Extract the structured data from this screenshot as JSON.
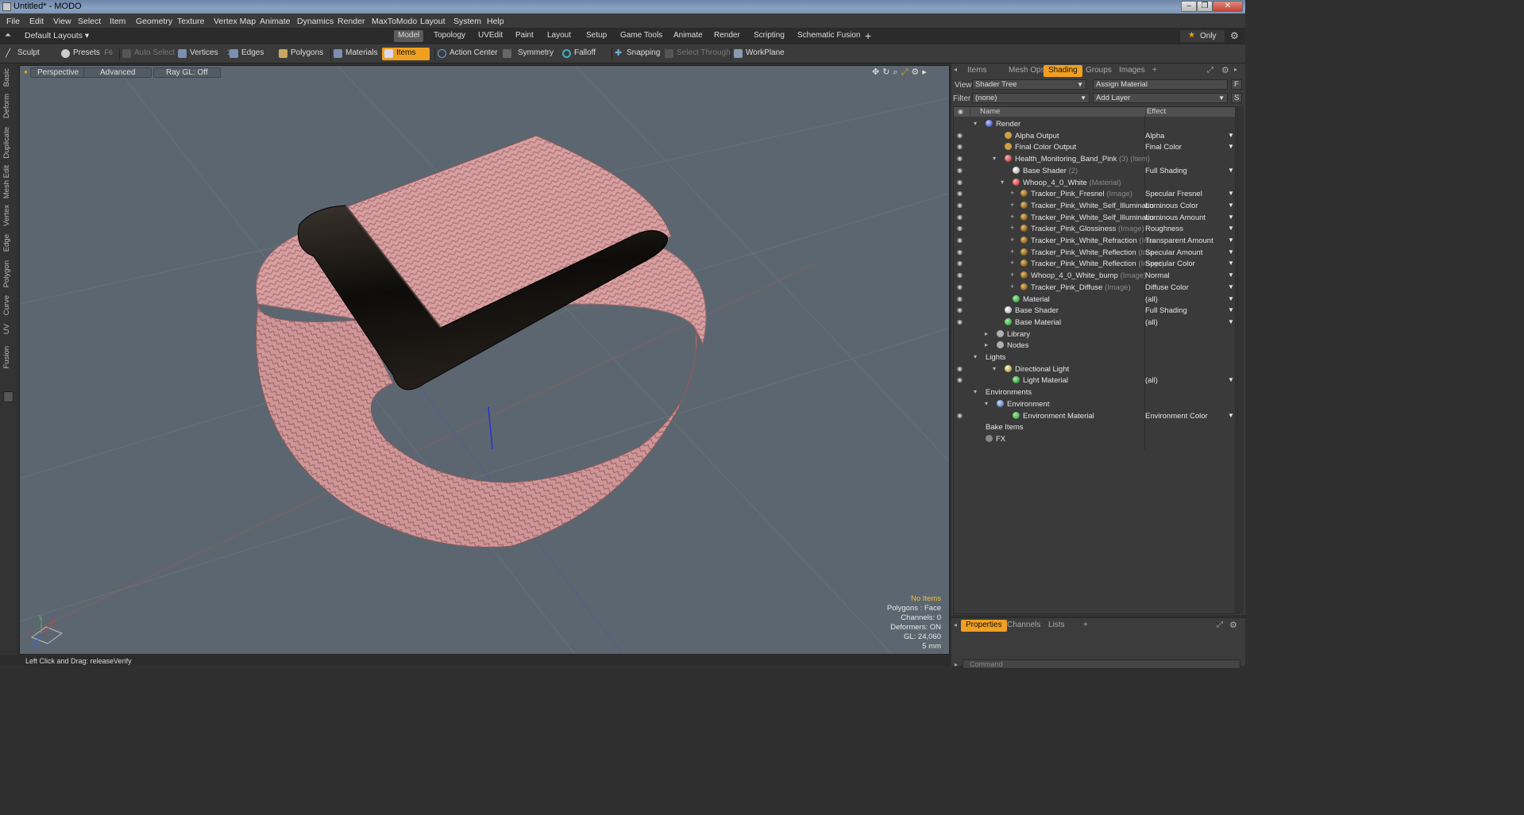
{
  "window": {
    "title": "Untitled* - MODO",
    "controls": [
      "–",
      "❐",
      "✕"
    ]
  },
  "menus": [
    "File",
    "Edit",
    "View",
    "Select",
    "Item",
    "Geometry",
    "Texture",
    "Vertex Map",
    "Animate",
    "Dynamics",
    "Render",
    "MaxToModo",
    "Layout",
    "System",
    "Help"
  ],
  "layout_selector": "Default Layouts",
  "mode_tabs": [
    "Model",
    "Topology",
    "UVEdit",
    "Paint",
    "Layout",
    "Setup",
    "Game Tools",
    "Animate",
    "Render",
    "Scripting",
    "Schematic Fusion"
  ],
  "mode_active": "Model",
  "add_tab": "+",
  "only_label": "Only",
  "toolbar": {
    "sculpt": "Sculpt",
    "presets": "Presets",
    "presets_key": "F6",
    "auto_select": "Auto Select",
    "vertices": "Vertices",
    "vertices_key": "1",
    "edges": "Edges",
    "edges_key": "2",
    "polygons": "Polygons",
    "materials": "Materials",
    "items": "Items",
    "action_center": "Action Center",
    "symmetry": "Symmetry",
    "falloff": "Falloff",
    "snapping": "Snapping",
    "select_through": "Select Through",
    "workplane": "WorkPlane"
  },
  "left_tabs": [
    "Basic",
    "Deform",
    "Duplicate",
    "Mesh Edit",
    "Vertex",
    "Edge",
    "Polygon",
    "Curve",
    "UV",
    "Fusion"
  ],
  "viewport": {
    "perspective": "Perspective",
    "advanced": "Advanced",
    "raygl": "Ray GL: Off",
    "hud": {
      "items": "No Items",
      "polygons": "Polygons : Face",
      "channels": "Channels: 0",
      "deformers": "Deformers: ON",
      "gl": "GL: 24,060",
      "unit": "5 mm"
    },
    "colors": {
      "band": "#d49a9c",
      "clasp": "#141210",
      "bg": "#5b6670"
    }
  },
  "panel": {
    "tabs": [
      "Items",
      "Mesh Ops",
      "Shading",
      "Groups",
      "Images"
    ],
    "active_tab": "Shading",
    "add": "+",
    "view_label": "View",
    "view_value": "Shader Tree",
    "assign_material": "Assign Material",
    "f_key": "F",
    "filter_label": "Filter",
    "filter_value": "(none)",
    "add_layer": "Add Layer",
    "s_key": "S",
    "col_name": "Name",
    "col_effect": "Effect",
    "rows": [
      {
        "name": "Render",
        "type": "",
        "effect": "",
        "eye": false,
        "glyph": "blue"
      },
      {
        "name": "Alpha Output",
        "type": "",
        "effect": "Alpha",
        "eye": true,
        "glyph": "output"
      },
      {
        "name": "Final Color Output",
        "type": "",
        "effect": "Final Color",
        "eye": true,
        "glyph": "output"
      },
      {
        "name": "Health_Monitoring_Band_Pink",
        "type": "(3) (Item)",
        "effect": "",
        "eye": true,
        "glyph": "red"
      },
      {
        "name": "Base Shader",
        "type": "(2)",
        "effect": "Full Shading",
        "eye": true,
        "glyph": "white"
      },
      {
        "name": "Whoop_4_0_White",
        "type": "(Material)",
        "effect": "",
        "eye": true,
        "glyph": "red"
      },
      {
        "name": "Tracker_Pink_Fresnel",
        "type": "(Image)",
        "effect": "Specular Fresnel",
        "eye": true,
        "glyph": "img"
      },
      {
        "name": "Tracker_Pink_White_Self_Illuminatio ...",
        "type": "",
        "effect": "Luminous Color",
        "eye": true,
        "glyph": "img"
      },
      {
        "name": "Tracker_Pink_White_Self_Illuminatio ...",
        "type": "",
        "effect": "Luminous Amount",
        "eye": true,
        "glyph": "img"
      },
      {
        "name": "Tracker_Pink_Glossiness",
        "type": "(Image)",
        "effect": "Roughness",
        "eye": true,
        "glyph": "img"
      },
      {
        "name": "Tracker_Pink_White_Refraction",
        "type": "(Ima ...",
        "effect": "Transparent Amount",
        "eye": true,
        "glyph": "img"
      },
      {
        "name": "Tracker_Pink_White_Reflection",
        "type": "(Ima ...",
        "effect": "Specular Amount",
        "eye": true,
        "glyph": "img"
      },
      {
        "name": "Tracker_Pink_White_Reflection",
        "type": "(Image)",
        "effect": "Specular Color",
        "eye": true,
        "glyph": "img"
      },
      {
        "name": "Whoop_4_0_White_bump",
        "type": "(Image)",
        "effect": "Normal",
        "eye": true,
        "glyph": "img"
      },
      {
        "name": "Tracker_Pink_Diffuse",
        "type": "(Image)",
        "effect": "Diffuse Color",
        "eye": true,
        "glyph": "img"
      },
      {
        "name": "Material",
        "type": "",
        "effect": "(all)",
        "eye": true,
        "glyph": "green"
      },
      {
        "name": "Base Shader",
        "type": "",
        "effect": "Full Shading",
        "eye": true,
        "glyph": "white"
      },
      {
        "name": "Base Material",
        "type": "",
        "effect": "(all)",
        "eye": true,
        "glyph": "green"
      },
      {
        "name": "Library",
        "type": "",
        "effect": "",
        "eye": false,
        "glyph": "folder"
      },
      {
        "name": "Nodes",
        "type": "",
        "effect": "",
        "eye": false,
        "glyph": "folder"
      },
      {
        "name": "Lights",
        "type": "",
        "effect": "",
        "eye": false,
        "glyph": "none"
      },
      {
        "name": "Directional Light",
        "type": "",
        "effect": "",
        "eye": true,
        "glyph": "light"
      },
      {
        "name": "Light Material",
        "type": "",
        "effect": "(all)",
        "eye": true,
        "glyph": "green"
      },
      {
        "name": "Environments",
        "type": "",
        "effect": "",
        "eye": false,
        "glyph": "none"
      },
      {
        "name": "Environment",
        "type": "",
        "effect": "",
        "eye": false,
        "glyph": "env"
      },
      {
        "name": "Environment Material",
        "type": "",
        "effect": "Environment Color",
        "eye": true,
        "glyph": "green"
      },
      {
        "name": "Bake Items",
        "type": "",
        "effect": "",
        "eye": false,
        "glyph": "none"
      },
      {
        "name": "FX",
        "type": "",
        "effect": "",
        "eye": false,
        "glyph": "fx"
      }
    ]
  },
  "bottom_tabs": [
    "Properties",
    "Channels",
    "Lists"
  ],
  "bottom_active": "Properties",
  "command_placeholder": "Command",
  "status": "Left Click and Drag:  releaseVerify"
}
